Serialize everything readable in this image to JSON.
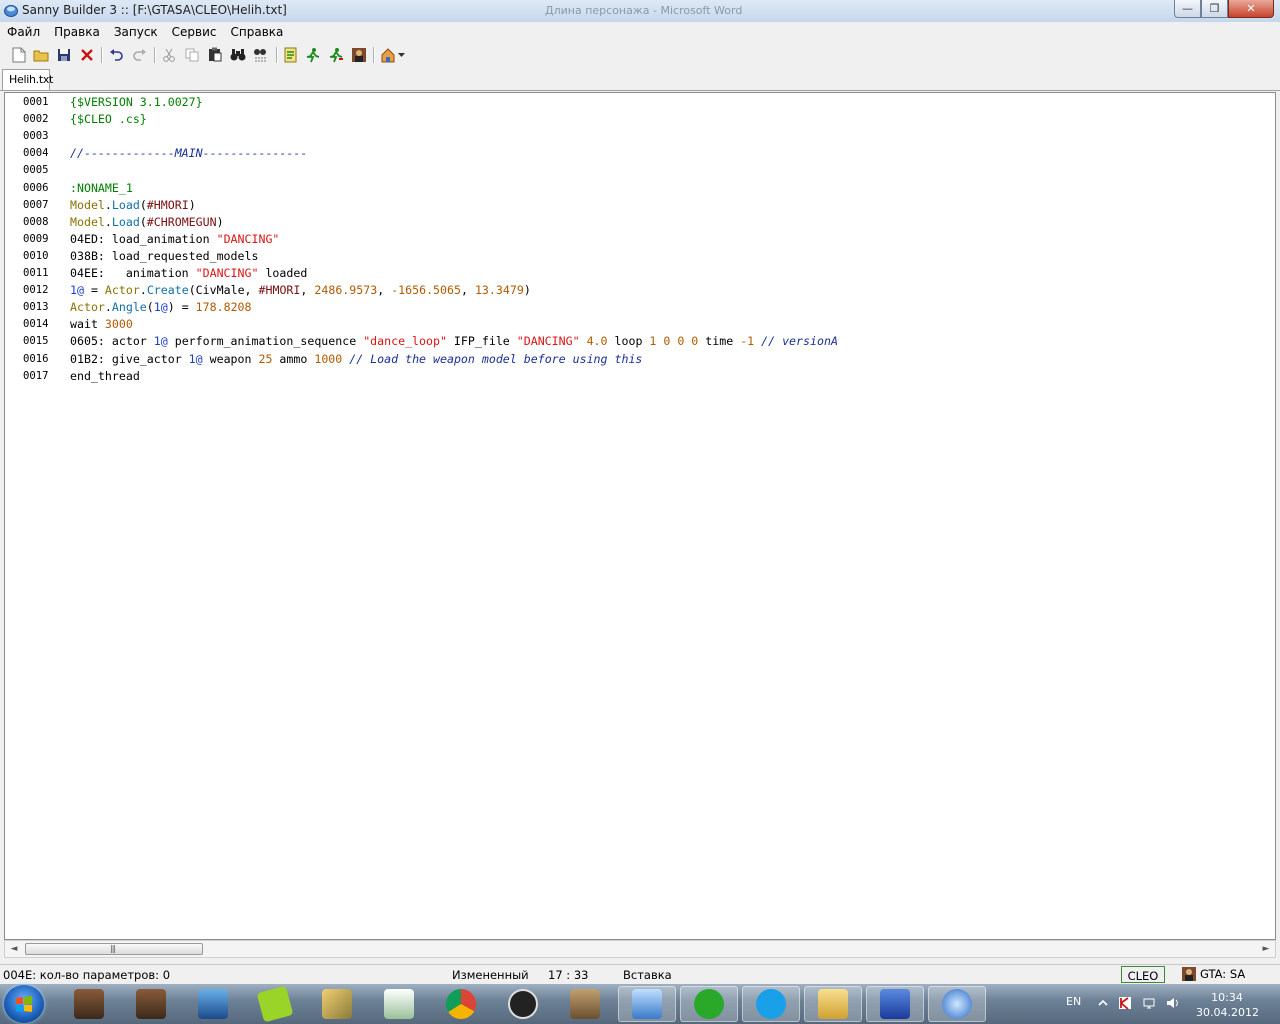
{
  "window": {
    "title": "Sanny Builder 3 :: [F:\\GTASA\\CLEO\\Helih.txt]",
    "background_title": "Длина персонажа - Microsoft Word",
    "minimize": "—",
    "maximize": "❐",
    "close": "✕"
  },
  "menu": [
    "Файл",
    "Правка",
    "Запуск",
    "Сервис",
    "Справка"
  ],
  "tabs": [
    "Helih.txt"
  ],
  "code_lines": [
    {
      "n": "0001",
      "t": [
        [
          "dir",
          "{$VERSION 3.1.0027}"
        ]
      ]
    },
    {
      "n": "0002",
      "t": [
        [
          "dir",
          "{$CLEO .cs}"
        ]
      ]
    },
    {
      "n": "0003",
      "t": []
    },
    {
      "n": "0004",
      "t": [
        [
          "com",
          "//-------------MAIN---------------"
        ]
      ]
    },
    {
      "n": "0005",
      "t": []
    },
    {
      "n": "0006",
      "t": [
        [
          "lbl",
          ":NONAME_1"
        ]
      ]
    },
    {
      "n": "0007",
      "t": [
        [
          "cls",
          "Model"
        ],
        [
          "",
          "."
        ],
        [
          "meth",
          "Load"
        ],
        [
          "",
          "("
        ],
        [
          "mdl",
          "#HMORI"
        ],
        [
          "",
          ")"
        ]
      ]
    },
    {
      "n": "0008",
      "t": [
        [
          "cls",
          "Model"
        ],
        [
          "",
          "."
        ],
        [
          "meth",
          "Load"
        ],
        [
          "",
          "("
        ],
        [
          "mdl",
          "#CHROMEGUN"
        ],
        [
          "",
          ")"
        ]
      ]
    },
    {
      "n": "0009",
      "t": [
        [
          "",
          "04ED: load_animation "
        ],
        [
          "str",
          "\"DANCING\""
        ]
      ]
    },
    {
      "n": "0010",
      "t": [
        [
          "",
          "038B: load_requested_models"
        ]
      ]
    },
    {
      "n": "0011",
      "t": [
        [
          "",
          "04EE:   animation "
        ],
        [
          "str",
          "\"DANCING\""
        ],
        [
          "",
          " loaded"
        ]
      ]
    },
    {
      "n": "0012",
      "t": [
        [
          "var",
          "1@"
        ],
        [
          "",
          " = "
        ],
        [
          "cls",
          "Actor"
        ],
        [
          "",
          "."
        ],
        [
          "meth",
          "Create"
        ],
        [
          "",
          "(CivMale, "
        ],
        [
          "mdl",
          "#HMORI"
        ],
        [
          "",
          ", "
        ],
        [
          "num",
          "2486.9573"
        ],
        [
          "",
          ", "
        ],
        [
          "num",
          "-1656.5065"
        ],
        [
          "",
          ", "
        ],
        [
          "num",
          "13.3479"
        ],
        [
          "",
          ")"
        ]
      ]
    },
    {
      "n": "0013",
      "t": [
        [
          "cls",
          "Actor"
        ],
        [
          "",
          "."
        ],
        [
          "meth",
          "Angle"
        ],
        [
          "",
          "("
        ],
        [
          "var",
          "1@"
        ],
        [
          "",
          ") = "
        ],
        [
          "num",
          "178.8208"
        ]
      ]
    },
    {
      "n": "0014",
      "t": [
        [
          "",
          "wait "
        ],
        [
          "num",
          "3000"
        ]
      ]
    },
    {
      "n": "0015",
      "t": [
        [
          "",
          "0605: actor "
        ],
        [
          "var",
          "1@"
        ],
        [
          "",
          " perform_animation_sequence "
        ],
        [
          "str",
          "\"dance_loop\""
        ],
        [
          "",
          " IFP_file "
        ],
        [
          "str",
          "\"DANCING\""
        ],
        [
          "",
          " "
        ],
        [
          "num",
          "4.0"
        ],
        [
          "",
          " loop "
        ],
        [
          "num",
          "1 0 0 0"
        ],
        [
          "",
          " time "
        ],
        [
          "num",
          "-1"
        ],
        [
          "",
          " "
        ],
        [
          "com",
          "// versionA"
        ]
      ]
    },
    {
      "n": "0016",
      "t": [
        [
          "",
          "01B2: give_actor "
        ],
        [
          "var",
          "1@"
        ],
        [
          "",
          " weapon "
        ],
        [
          "num",
          "25"
        ],
        [
          "",
          " ammo "
        ],
        [
          "num",
          "1000"
        ],
        [
          "",
          " "
        ],
        [
          "com",
          "// Load the weapon model before using this"
        ]
      ]
    },
    {
      "n": "0017",
      "t": [
        [
          "",
          "end_thread"
        ]
      ]
    }
  ],
  "scrollbar": {
    "left": "◄",
    "right": "►",
    "grip": "|||"
  },
  "status": {
    "hint": "004E: кол-во параметров: 0",
    "modified": "Измененный",
    "position": "17 : 33",
    "mode": "Вставка",
    "cleo": "CLEO",
    "game": "GTA: SA"
  },
  "tray": {
    "lang": "EN",
    "time": "10:34",
    "date": "30.04.2012"
  },
  "colors": {
    "directive": "#008000",
    "string": "#dc1414",
    "comment": "#1a2f9a",
    "number": "#b05a00"
  }
}
